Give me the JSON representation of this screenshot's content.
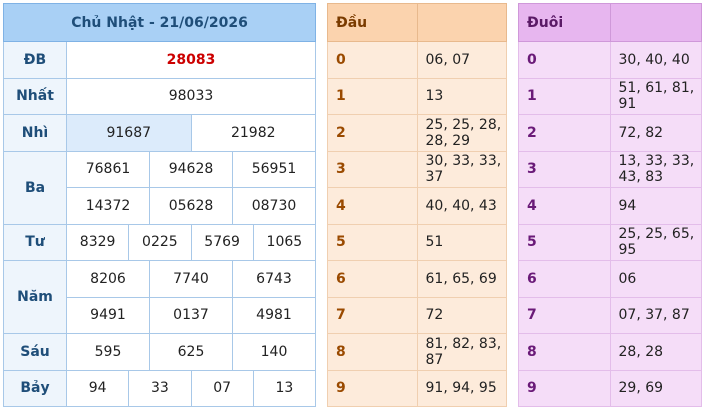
{
  "results": {
    "title": "Chủ Nhật - 21/06/2026",
    "rows": {
      "db": {
        "label": "ĐB",
        "values": [
          "28083"
        ]
      },
      "nhat": {
        "label": "Nhất",
        "values": [
          "98033"
        ]
      },
      "nhi": {
        "label": "Nhì",
        "values": [
          "91687",
          "21982"
        ]
      },
      "ba": {
        "label": "Ba",
        "values": [
          "76861",
          "94628",
          "56951",
          "14372",
          "05628",
          "08730"
        ]
      },
      "tu": {
        "label": "Tư",
        "values": [
          "8329",
          "0225",
          "5769",
          "1065"
        ]
      },
      "nam": {
        "label": "Năm",
        "values": [
          "8206",
          "7740",
          "6743",
          "9491",
          "0137",
          "4981"
        ]
      },
      "sau": {
        "label": "Sáu",
        "values": [
          "595",
          "625",
          "140"
        ]
      },
      "bay": {
        "label": "Bảy",
        "values": [
          "94",
          "33",
          "07",
          "13"
        ]
      }
    }
  },
  "dau": {
    "title": "Đầu",
    "rows": [
      {
        "k": "0",
        "v": "06, 07"
      },
      {
        "k": "1",
        "v": "13"
      },
      {
        "k": "2",
        "v": "25, 25, 28, 28, 29"
      },
      {
        "k": "3",
        "v": "30, 33, 33, 37"
      },
      {
        "k": "4",
        "v": "40, 40, 43"
      },
      {
        "k": "5",
        "v": "51"
      },
      {
        "k": "6",
        "v": "61, 65, 69"
      },
      {
        "k": "7",
        "v": "72"
      },
      {
        "k": "8",
        "v": "81, 82, 83, 87"
      },
      {
        "k": "9",
        "v": "91, 94, 95"
      }
    ]
  },
  "duoi": {
    "title": "Đuôi",
    "rows": [
      {
        "k": "0",
        "v": "30, 40, 40"
      },
      {
        "k": "1",
        "v": "51, 61, 81, 91"
      },
      {
        "k": "2",
        "v": "72, 82"
      },
      {
        "k": "3",
        "v": "13, 33, 33, 43, 83"
      },
      {
        "k": "4",
        "v": "94"
      },
      {
        "k": "5",
        "v": "25, 25, 65, 95"
      },
      {
        "k": "6",
        "v": "06"
      },
      {
        "k": "7",
        "v": "07, 37, 87"
      },
      {
        "k": "8",
        "v": "28, 28"
      },
      {
        "k": "9",
        "v": "29, 69"
      }
    ]
  },
  "colors": {
    "special_prize": "#cc0000",
    "results_header": "#a9d0f5",
    "dau_header": "#fbd3ae",
    "duoi_header": "#e7b6ef"
  }
}
